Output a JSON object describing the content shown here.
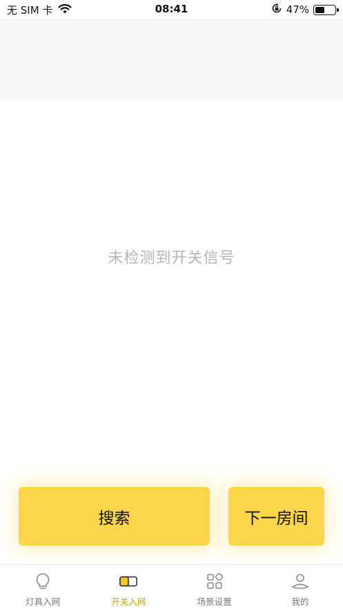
{
  "status_bar": {
    "carrier": "无 SIM 卡",
    "time": "08:41",
    "battery": "47%",
    "battery_level": 0.47
  },
  "main": {
    "empty_message": "未检测到开关信号"
  },
  "actions": {
    "search_label": "搜索",
    "next_room_label": "下一房间"
  },
  "tabs": [
    {
      "label": "灯具入网",
      "icon": "bulb-icon",
      "active": false
    },
    {
      "label": "开关入网",
      "icon": "switch-icon",
      "active": true
    },
    {
      "label": "场景设置",
      "icon": "scene-grid-icon",
      "active": false
    },
    {
      "label": "我的",
      "icon": "profile-icon",
      "active": false
    }
  ],
  "colors": {
    "accent": "#fbd54a",
    "active_tab_text": "#c9a200",
    "empty_text": "#b5b5b5",
    "header_band": "#f7f7f7"
  }
}
